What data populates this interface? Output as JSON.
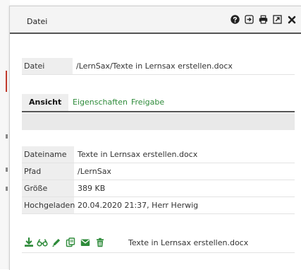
{
  "window": {
    "title": "Datei"
  },
  "title_icons": [
    "help-icon",
    "export-icon",
    "print-icon",
    "maximize-icon",
    "close-icon"
  ],
  "file_path": {
    "label": "Datei",
    "value": "/LernSax/Texte in Lernsax erstellen.docx"
  },
  "tabs": [
    {
      "label": "Ansicht",
      "active": true
    },
    {
      "label": "Eigenschaften",
      "active": false
    },
    {
      "label": "Freigabe",
      "active": false
    }
  ],
  "properties": [
    {
      "label": "Dateiname",
      "value": "Texte in Lernsax erstellen.docx"
    },
    {
      "label": "Pfad",
      "value": "/LernSax"
    },
    {
      "label": "Größe",
      "value": "389 KB"
    },
    {
      "label": "Hochgeladen",
      "value": "20.04.2020 21:37, Herr Herwig"
    }
  ],
  "actions": {
    "icons": [
      "download-icon",
      "view-icon",
      "edit-icon",
      "copy-icon",
      "mail-icon",
      "delete-icon"
    ],
    "filename": "Texte in Lernsax erstellen.docx"
  },
  "colors": {
    "accent_green": "#2e8b3a",
    "close_red": "#c0392b",
    "icon_dark": "#222222"
  }
}
